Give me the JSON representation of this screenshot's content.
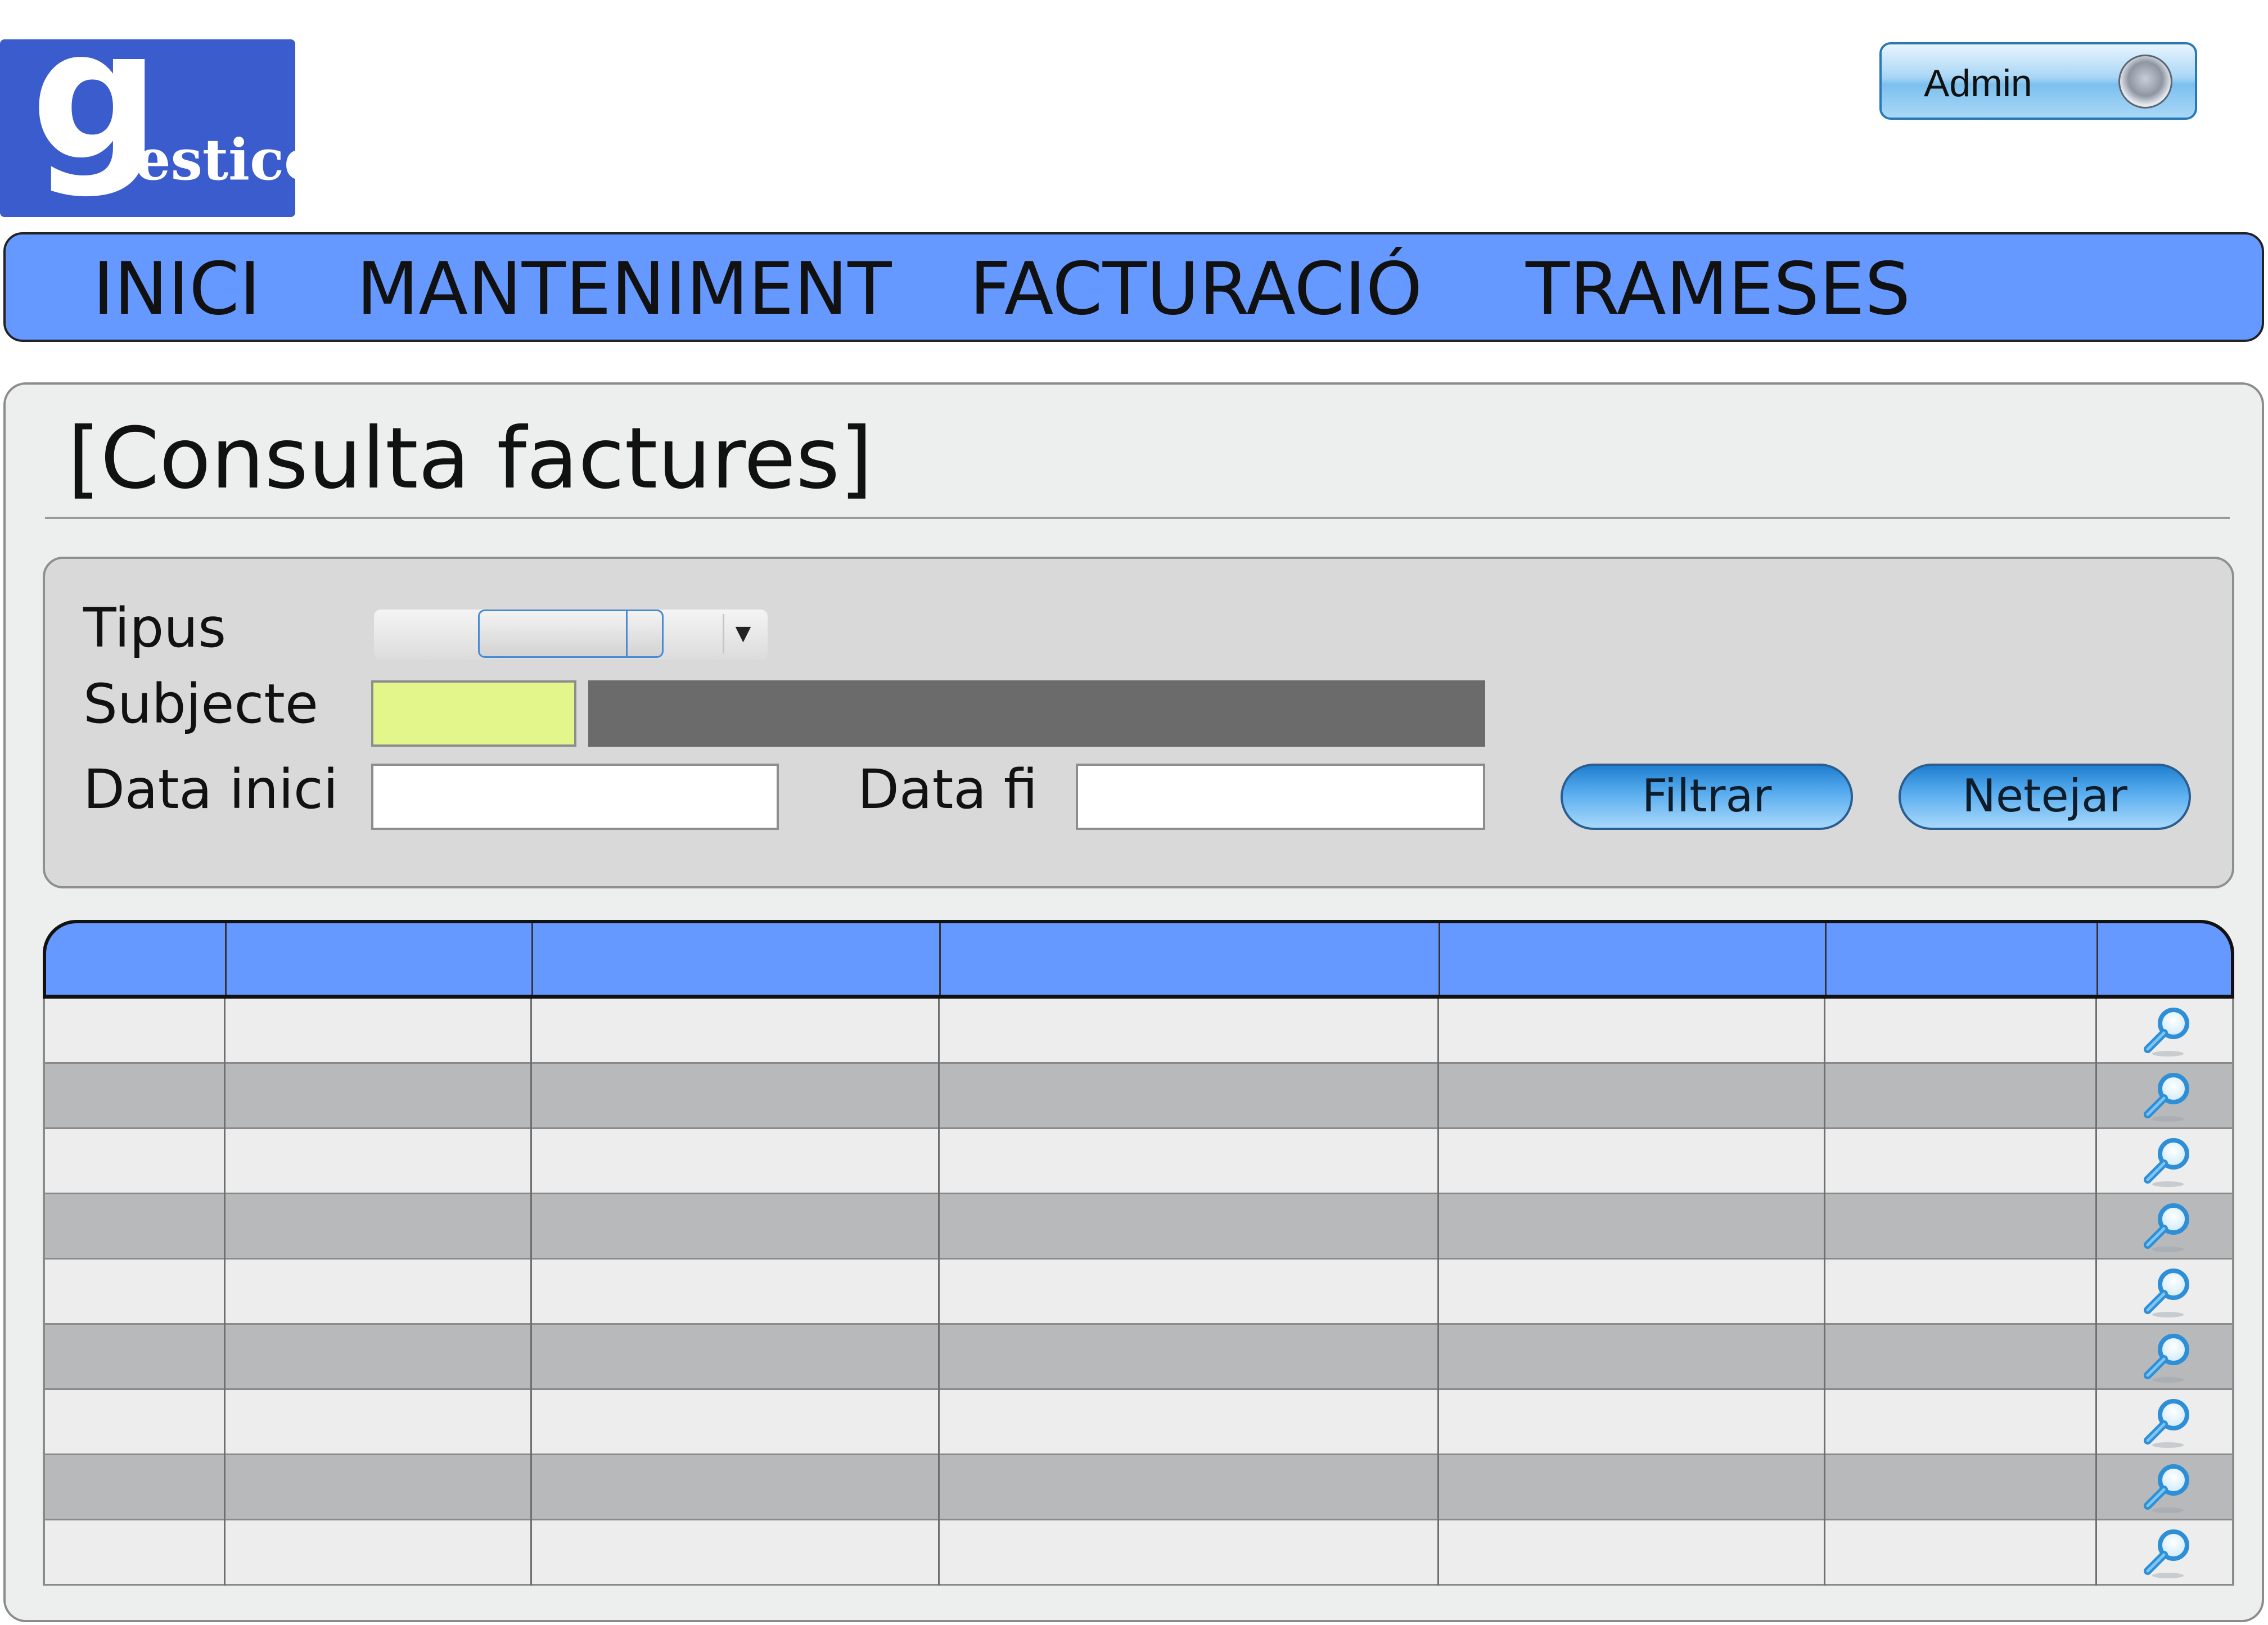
{
  "logo": {
    "letter": "g",
    "rest": "esticc"
  },
  "header": {
    "user_button_label": "Admin"
  },
  "nav": {
    "items": [
      {
        "label": "INICI"
      },
      {
        "label": "MANTENIMENT"
      },
      {
        "label": "FACTURACIÓ"
      },
      {
        "label": "TRAMESES"
      }
    ]
  },
  "page": {
    "title": "[Consulta factures]"
  },
  "filters": {
    "tipus_label": "Tipus",
    "tipus_value": "",
    "subjecte_label": "Subjecte",
    "subjecte_code_value": "",
    "subjecte_name_value": "",
    "data_inici_label": "Data inici",
    "data_inici_value": "",
    "data_fi_label": "Data fi",
    "data_fi_value": "",
    "filter_button": "Filtrar",
    "clear_button": "Netejar"
  },
  "table": {
    "headers": [
      "",
      "",
      "",
      "",
      "",
      "",
      ""
    ],
    "rows": [
      [
        "",
        "",
        "",
        "",
        "",
        ""
      ],
      [
        "",
        "",
        "",
        "",
        "",
        ""
      ],
      [
        "",
        "",
        "",
        "",
        "",
        ""
      ],
      [
        "",
        "",
        "",
        "",
        "",
        ""
      ],
      [
        "",
        "",
        "",
        "",
        "",
        ""
      ],
      [
        "",
        "",
        "",
        "",
        "",
        ""
      ],
      [
        "",
        "",
        "",
        "",
        "",
        ""
      ],
      [
        "",
        "",
        "",
        "",
        "",
        ""
      ],
      [
        "",
        "",
        "",
        "",
        "",
        ""
      ]
    ],
    "row_action_icon": "magnifier-icon"
  },
  "colors": {
    "nav_bg": "#6699ff",
    "logo_bg": "#3a5ccc",
    "subjecte_code_bg": "#e2f68c",
    "subjecte_name_bg": "#6b6b6b",
    "row_alt_bg": "#b7b9ba",
    "panel_bg": "#edeeee",
    "filter_panel_bg": "#d9d9d9"
  }
}
